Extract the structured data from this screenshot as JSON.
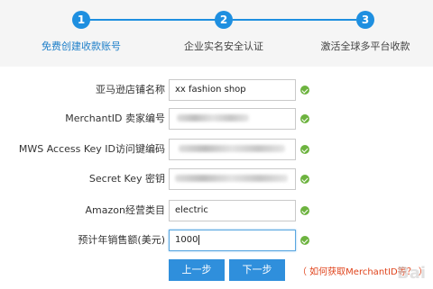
{
  "steps": [
    {
      "number": "1",
      "label": "免费创建收款账号"
    },
    {
      "number": "2",
      "label": "企业实名安全认证"
    },
    {
      "number": "3",
      "label": "激活全球多平台收款"
    }
  ],
  "form": {
    "rows": [
      {
        "label": "亚马逊店铺名称",
        "value": "xx fashion shop",
        "blurred": false
      },
      {
        "label": "MerchantID 卖家编号",
        "value": "",
        "blurred": true
      },
      {
        "label": "MWS Access Key ID访问键编码",
        "value": "",
        "blurred": true
      },
      {
        "label": "Secret Key 密钥",
        "value": "",
        "blurred": true
      },
      {
        "label": "Amazon经营类目",
        "value": "electric",
        "blurred": false
      },
      {
        "label": "预计年销售额(美元)",
        "value": "1000",
        "blurred": false
      }
    ]
  },
  "buttons": {
    "prev_label": "上一步",
    "next_label": "下一步"
  },
  "help_link": "（ 如何获取MerchantID等？ ）",
  "colors": {
    "accent": "#1e8fe0",
    "button": "#2f8fdc",
    "check": "#6db33f",
    "help_link": "#e0431b"
  }
}
